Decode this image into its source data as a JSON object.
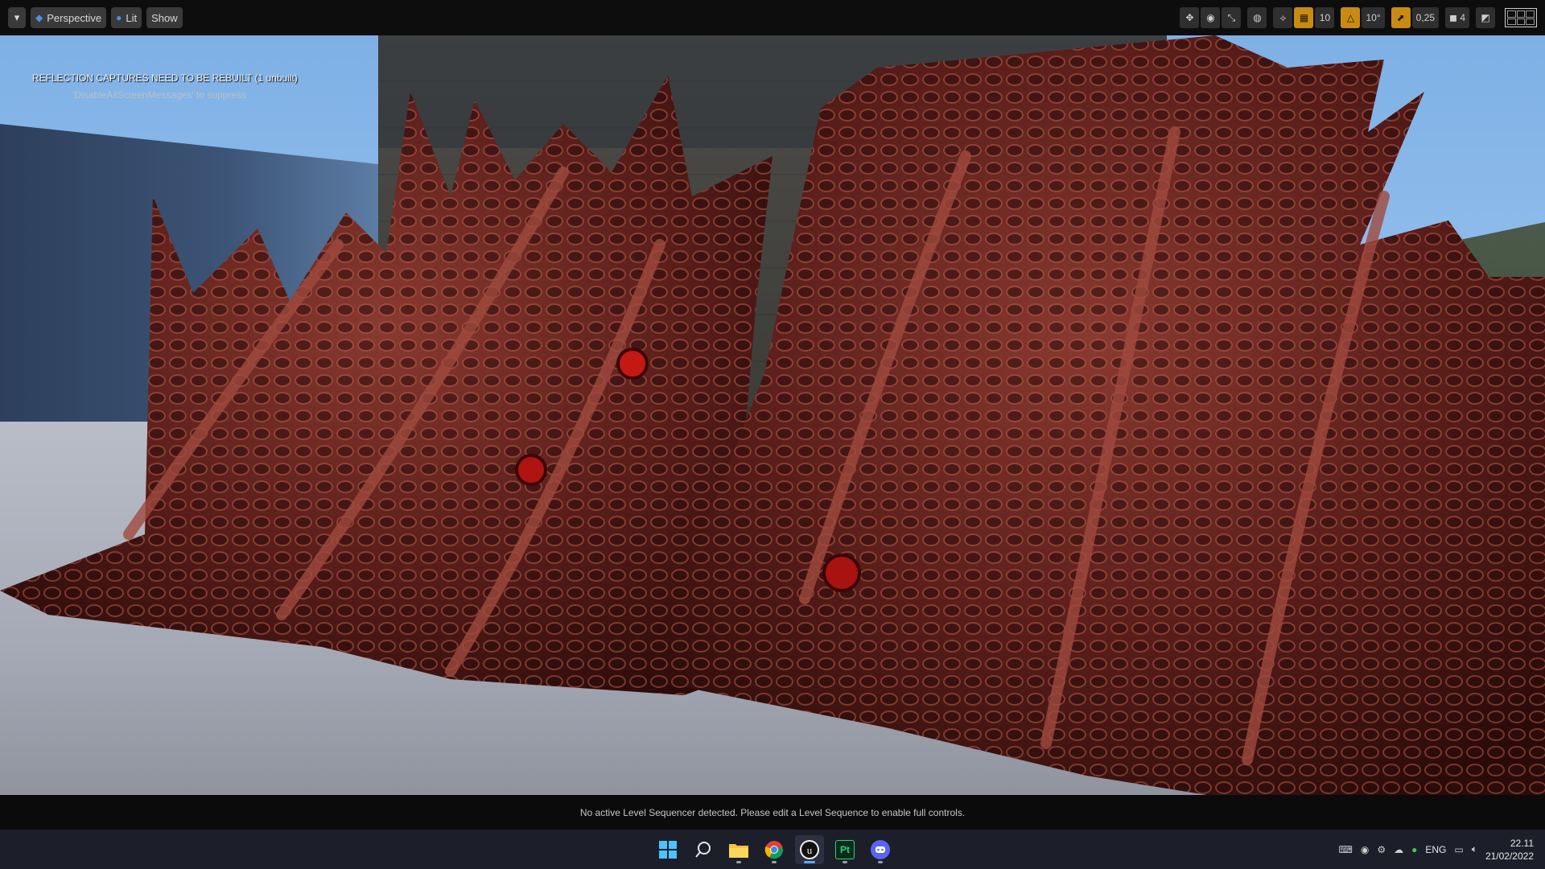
{
  "toolbar": {
    "view_mode": "Perspective",
    "lighting": "Lit",
    "show": "Show",
    "grid_snap": "10",
    "rotation_snap": "10°",
    "scale_snap": "0,25",
    "camera_speed": "4"
  },
  "viewport": {
    "warning": "REFLECTION CAPTURES NEED TO BE REBUILT (1 unbuilt)",
    "suppress_hint": "'DisableAllScreenMessages' to suppress"
  },
  "sequencer": {
    "message": "No active Level Sequencer detected. Please edit a Level Sequence to enable full controls."
  },
  "taskbar": {
    "apps": [
      {
        "name": "start",
        "label": "",
        "active": false
      },
      {
        "name": "search",
        "label": "",
        "active": false
      },
      {
        "name": "file-explorer",
        "label": "",
        "active": false
      },
      {
        "name": "chrome",
        "label": "",
        "active": false
      },
      {
        "name": "unreal-engine",
        "label": "",
        "active": true
      },
      {
        "name": "painter",
        "label": "Pt",
        "active": false
      },
      {
        "name": "discord",
        "label": "",
        "active": false
      }
    ],
    "language": "ENG",
    "time": "22.11",
    "date": "21/02/2022"
  },
  "colors": {
    "accent_orange": "#c98a12",
    "accent_blue": "#4e8fe8"
  }
}
